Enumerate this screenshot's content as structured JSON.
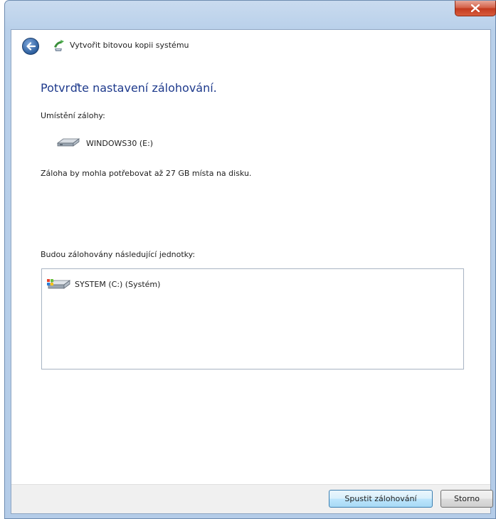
{
  "window": {
    "title": "Vytvořit bitovou kopii systému"
  },
  "content": {
    "heading": "Potvrďte nastavení zálohování.",
    "location_label": "Umístění zálohy:",
    "backup_drive": "WINDOWS30 (E:)",
    "size_text": "Záloha by mohla potřebovat až 27 GB místa na disku.",
    "drives_label": "Budou zálohovány následující jednotky:",
    "drives": [
      {
        "label": "SYSTEM (C:) (Systém)"
      }
    ]
  },
  "footer": {
    "start_label": "Spustit zálohování",
    "cancel_label": "Storno"
  },
  "colors": {
    "heading": "#1e3a8c",
    "close_button": "#c23a1f",
    "frame": "#b9d0ea"
  }
}
